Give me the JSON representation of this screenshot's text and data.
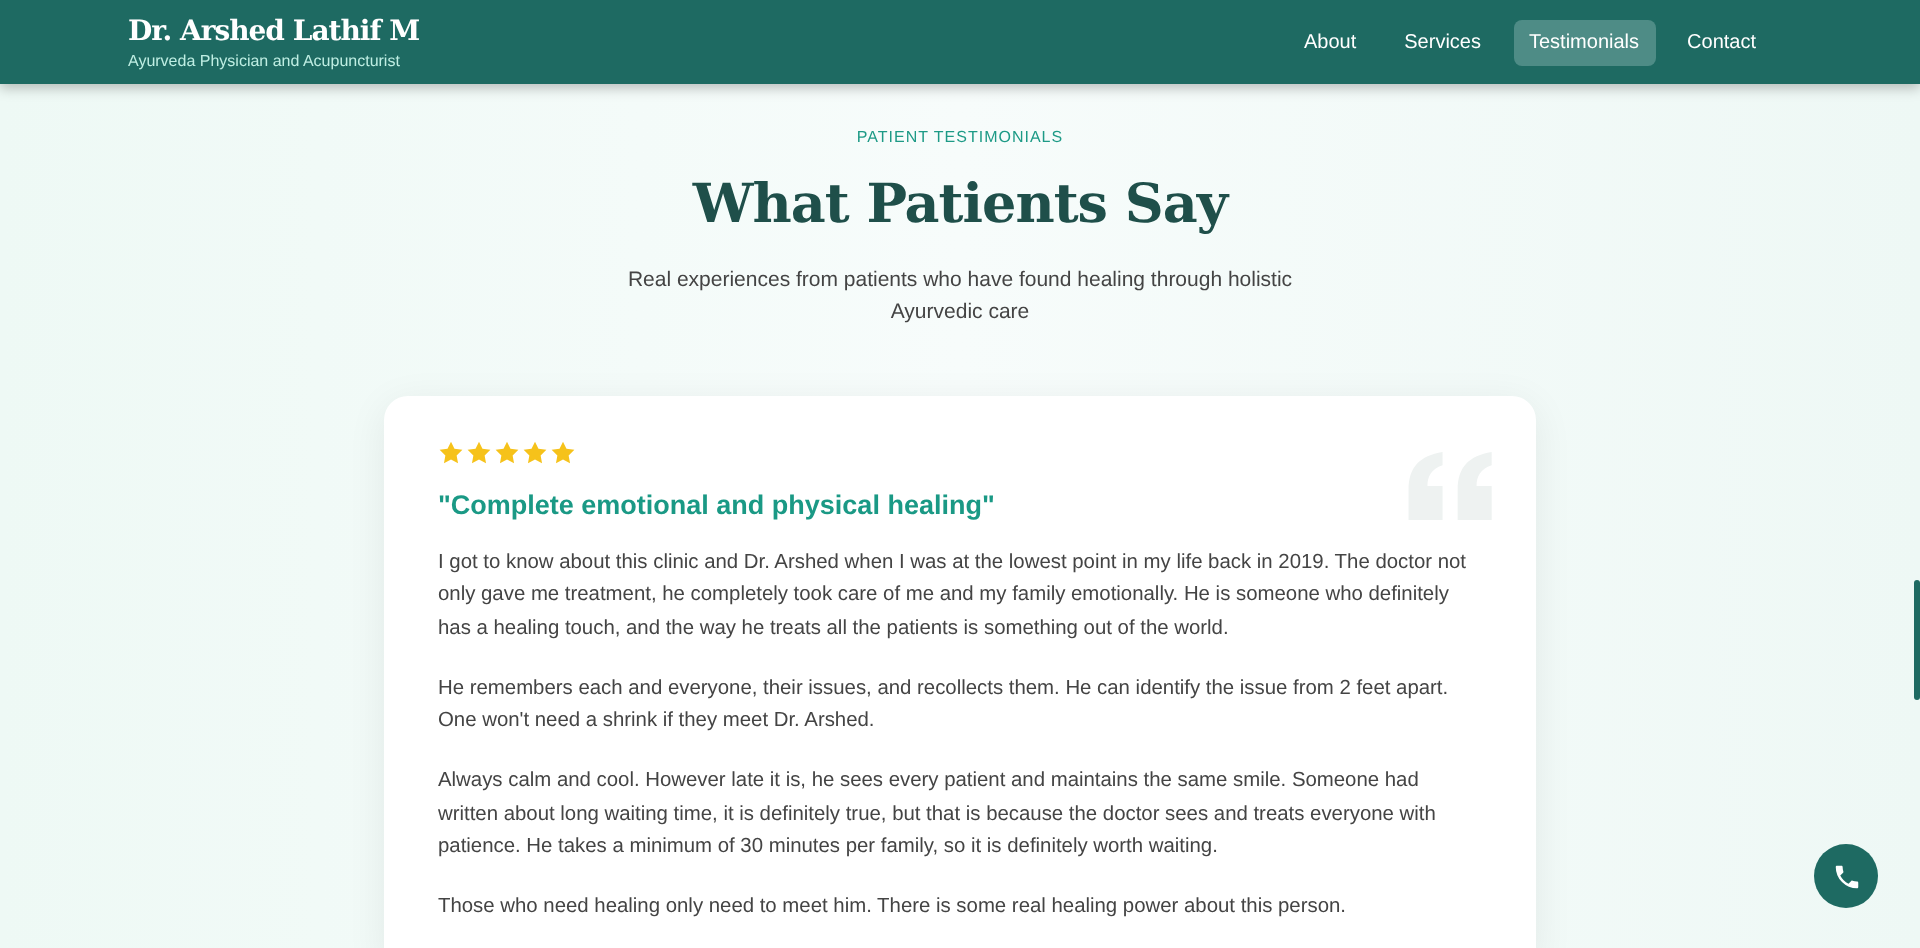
{
  "header": {
    "name": "Dr. Arshed Lathif M",
    "subtitle": "Ayurveda Physician and Acupuncturist",
    "nav": [
      {
        "label": "About",
        "selected": false
      },
      {
        "label": "Services",
        "selected": false
      },
      {
        "label": "Testimonials",
        "selected": true
      },
      {
        "label": "Contact",
        "selected": false
      }
    ]
  },
  "section": {
    "eyebrow": "PATIENT TESTIMONIALS",
    "title": "What Patients Say",
    "intro": "Real experiences from patients who have found healing through holistic Ayurvedic care"
  },
  "testimonial": {
    "stars": 5,
    "headline": "\"Complete emotional and physical healing\"",
    "paragraphs": [
      "I got to know about this clinic and Dr. Arshed when I was at the lowest point in my life back in 2019. The doctor not only gave me treatment, he completely took care of me and my family emotionally. He is someone who definitely has a healing touch, and the way he treats all the patients is something out of the world.",
      "He remembers each and everyone, their issues, and recollects them. He can identify the issue from 2 feet apart. One won't need a shrink if they meet Dr. Arshed.",
      "Always calm and cool. However late it is, he sees every patient and maintains the same smile. Someone had written about long waiting time, it is definitely true, but that is because the doctor sees and treats everyone with patience. He takes a minimum of 30 minutes per family, so it is definitely worth waiting.",
      "Those who need healing only need to meet him. There is some real healing power about this person."
    ]
  }
}
